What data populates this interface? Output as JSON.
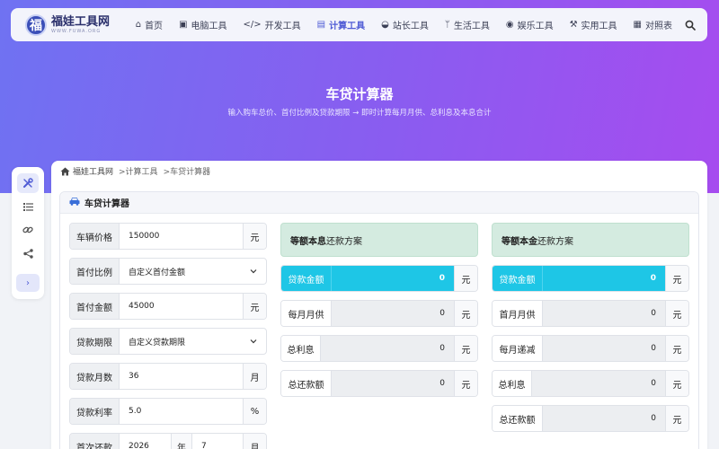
{
  "logo": {
    "mark": "福",
    "name": "福娃工具网",
    "sub": "WWW.FUWA.ORG"
  },
  "nav": [
    {
      "icon": "⌂",
      "label": "首页",
      "active": false
    },
    {
      "icon": "▣",
      "label": "电脑工具",
      "active": false
    },
    {
      "icon": "</>",
      "label": "开发工具",
      "active": false
    },
    {
      "icon": "▤",
      "label": "计算工具",
      "active": true
    },
    {
      "icon": "◒",
      "label": "站长工具",
      "active": false
    },
    {
      "icon": "ᛘ",
      "label": "生活工具",
      "active": false
    },
    {
      "icon": "◉",
      "label": "娱乐工具",
      "active": false
    },
    {
      "icon": "⚒",
      "label": "实用工具",
      "active": false
    },
    {
      "icon": "▦",
      "label": "对照表",
      "active": false
    }
  ],
  "hero": {
    "title": "车贷计算器",
    "subtitle": "输入购车总价、首付比例及贷款期限 → 即时计算每月月供、总利息及本息合计"
  },
  "breadcrumb": {
    "home": "福娃工具网",
    "cat": ">计算工具",
    "page": ">车贷计算器"
  },
  "panel": {
    "title": "车贷计算器"
  },
  "inputs": {
    "price": {
      "label": "车辆价格",
      "value": "150000",
      "unit": "元"
    },
    "ratio": {
      "label": "首付比例",
      "value": "自定义首付金额"
    },
    "down": {
      "label": "首付金额",
      "value": "45000",
      "unit": "元"
    },
    "term": {
      "label": "贷款期限",
      "value": "自定义贷款期限"
    },
    "months": {
      "label": "贷款月数",
      "value": "36",
      "unit": "月"
    },
    "rate": {
      "label": "贷款利率",
      "value": "5.0",
      "unit": "%"
    },
    "first": {
      "label": "首次还款",
      "year": "2026",
      "year_unit": "年",
      "month": "7",
      "month_unit": "月"
    }
  },
  "plan1": {
    "title_bold": "等额本息",
    "title_rest": "还款方案",
    "rows": [
      {
        "label": "贷款金额",
        "value": "0",
        "unit": "元"
      },
      {
        "label": "每月月供",
        "value": "0",
        "unit": "元"
      },
      {
        "label": "总利息",
        "value": "0",
        "unit": "元"
      },
      {
        "label": "总还款额",
        "value": "0",
        "unit": "元"
      }
    ]
  },
  "plan2": {
    "title_bold": "等额本金",
    "title_rest": "还款方案",
    "rows": [
      {
        "label": "贷款金额",
        "value": "0",
        "unit": "元"
      },
      {
        "label": "首月月供",
        "value": "0",
        "unit": "元"
      },
      {
        "label": "每月递减",
        "value": "0",
        "unit": "元"
      },
      {
        "label": "总利息",
        "value": "0",
        "unit": "元"
      },
      {
        "label": "总还款额",
        "value": "0",
        "unit": "元"
      }
    ]
  },
  "sidebar": {
    "expand": "›"
  },
  "colors": {
    "accent": "#4f5bd5",
    "highlight": "#1ec6e6",
    "plan_head": "#d4ebe0"
  }
}
